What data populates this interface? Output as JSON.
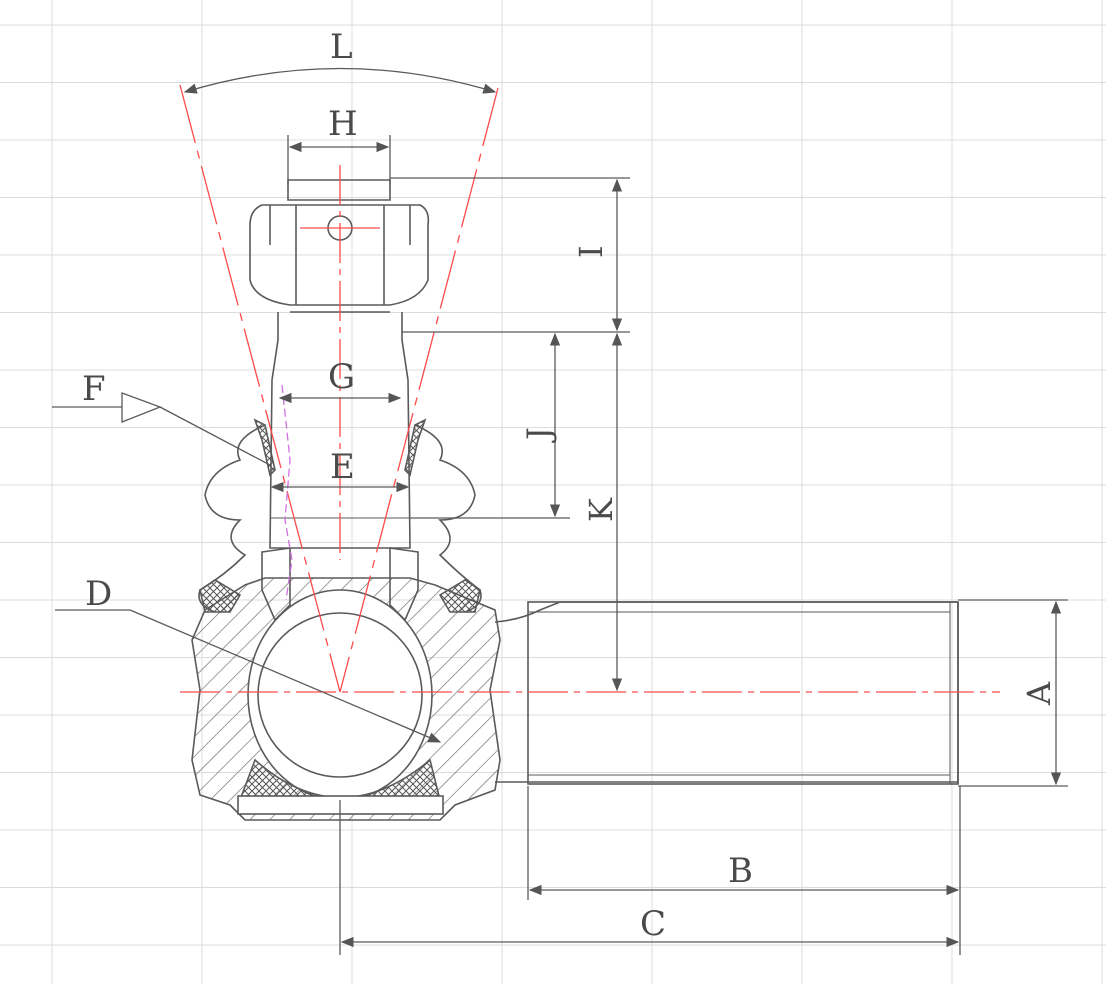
{
  "drawing": {
    "labels": {
      "A": "A",
      "B": "B",
      "C": "C",
      "D": "D",
      "E": "E",
      "F": "F",
      "G": "G",
      "H": "H",
      "I": "I",
      "J": "J",
      "K": "K",
      "L": "L"
    }
  },
  "colors": {
    "background": "#ffffff",
    "grid": "#dcdcdc",
    "line": "#5a5a5a",
    "centerline": "#ff4a4a",
    "accent": "#d070e0"
  }
}
